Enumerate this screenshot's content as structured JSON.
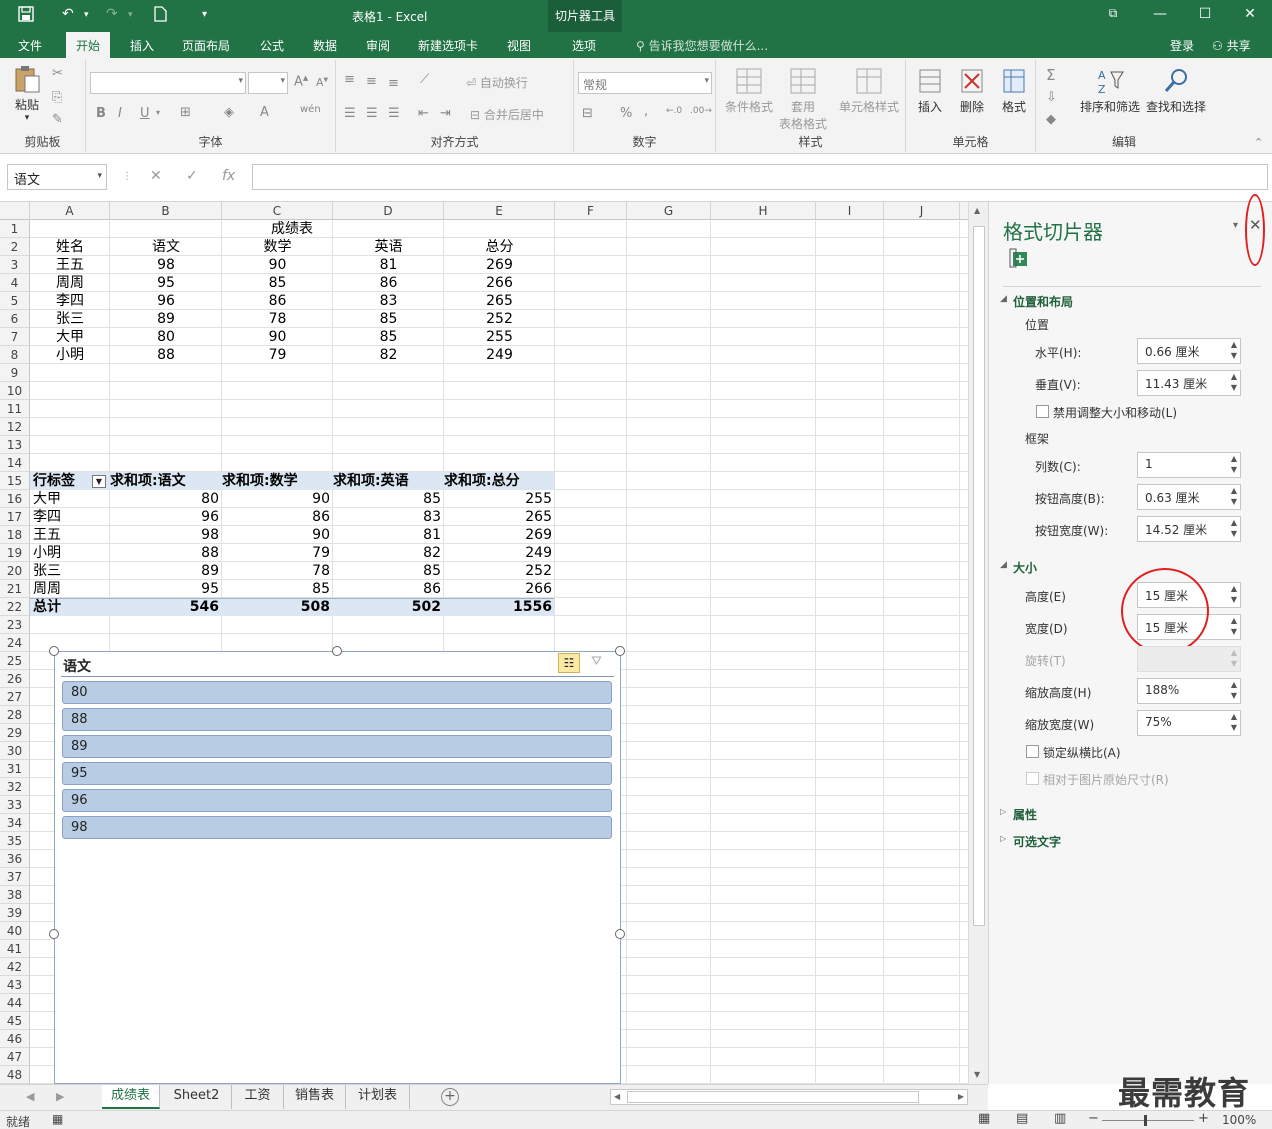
{
  "title_bar": {
    "title": "表格1 - Excel",
    "context_tool": "切片器工具",
    "save_icon": "save-icon",
    "undo_icon": "undo-icon",
    "redo_icon": "redo-icon",
    "new_icon": "new-file-icon"
  },
  "tabs": {
    "file": "文件",
    "home": "开始",
    "insert": "插入",
    "page_layout": "页面布局",
    "formulas": "公式",
    "data": "数据",
    "review": "审阅",
    "new_tab": "新建选项卡",
    "view": "视图",
    "options": "选项",
    "tell_me": "告诉我您想要做什么...",
    "signin": "登录",
    "share": "共享"
  },
  "ribbon": {
    "clipboard": {
      "paste": "粘贴",
      "label": "剪贴板"
    },
    "font": {
      "label": "字体",
      "wen": "wén"
    },
    "alignment": {
      "wrap": "自动换行",
      "merge": "合并后居中",
      "label": "对齐方式"
    },
    "number": {
      "format": "常规",
      "label": "数字",
      "percent": "%"
    },
    "styles": {
      "conditional": "条件格式",
      "table_line1": "套用",
      "table_line2": "表格格式",
      "cell_styles": "单元格样式",
      "label": "样式"
    },
    "cells": {
      "insert": "插入",
      "delete": "删除",
      "format": "格式",
      "label": "单元格"
    },
    "editing": {
      "sort_filter": "排序和筛选",
      "find_select": "查找和选择",
      "label": "编辑"
    }
  },
  "formula_bar": {
    "name_box": "语文",
    "cancel": "✕",
    "enter": "✓",
    "fx": "fx",
    "value": ""
  },
  "columns": [
    "A",
    "B",
    "C",
    "D",
    "E",
    "F",
    "G",
    "H",
    "I",
    "J"
  ],
  "rows": [
    "1",
    "2",
    "3",
    "4",
    "5",
    "6",
    "7",
    "8",
    "9",
    "10",
    "11",
    "12",
    "13",
    "14",
    "15",
    "16",
    "17",
    "18",
    "19",
    "20",
    "21",
    "22",
    "23",
    "24",
    "25",
    "26",
    "27",
    "28",
    "29",
    "30",
    "31",
    "32",
    "33",
    "34",
    "35",
    "36",
    "37",
    "38",
    "39",
    "40",
    "41",
    "42",
    "43",
    "44",
    "45",
    "46",
    "47",
    "48"
  ],
  "score_table": {
    "title": "成绩表",
    "headers": [
      "姓名",
      "语文",
      "数学",
      "英语",
      "总分"
    ],
    "rows": [
      [
        "王五",
        "98",
        "90",
        "81",
        "269"
      ],
      [
        "周周",
        "95",
        "85",
        "86",
        "266"
      ],
      [
        "李四",
        "96",
        "86",
        "83",
        "265"
      ],
      [
        "张三",
        "89",
        "78",
        "85",
        "252"
      ],
      [
        "大甲",
        "80",
        "90",
        "85",
        "255"
      ],
      [
        "小明",
        "88",
        "79",
        "82",
        "249"
      ]
    ]
  },
  "pivot_table": {
    "headers": [
      "行标签",
      "求和项:语文",
      "求和项:数学",
      "求和项:英语",
      "求和项:总分"
    ],
    "rows": [
      [
        "大甲",
        "80",
        "90",
        "85",
        "255"
      ],
      [
        "李四",
        "96",
        "86",
        "83",
        "265"
      ],
      [
        "王五",
        "98",
        "90",
        "81",
        "269"
      ],
      [
        "小明",
        "88",
        "79",
        "82",
        "249"
      ],
      [
        "张三",
        "89",
        "78",
        "85",
        "252"
      ],
      [
        "周周",
        "95",
        "85",
        "86",
        "266"
      ]
    ],
    "total": [
      "总计",
      "546",
      "508",
      "502",
      "1556"
    ]
  },
  "slicer": {
    "title": "语文",
    "items": [
      "80",
      "88",
      "89",
      "95",
      "96",
      "98"
    ]
  },
  "format_pane": {
    "title": "格式切片器",
    "section_position": "位置和布局",
    "position_label": "位置",
    "horizontal_label": "水平(H):",
    "horizontal_value": "0.66 厘米",
    "vertical_label": "垂直(V):",
    "vertical_value": "11.43 厘米",
    "disable_resize": "禁用调整大小和移动(L)",
    "frame_label": "框架",
    "columns_label": "列数(C):",
    "columns_value": "1",
    "button_height_label": "按钮高度(B):",
    "button_height_value": "0.63 厘米",
    "button_width_label": "按钮宽度(W):",
    "button_width_value": "14.52 厘米",
    "section_size": "大小",
    "height_label": "高度(E)",
    "height_value": "15 厘米",
    "width_label": "宽度(D)",
    "width_value": "15 厘米",
    "rotation_label": "旋转(T)",
    "rotation_value": "",
    "scale_height_label": "缩放高度(H)",
    "scale_height_value": "188%",
    "scale_width_label": "缩放宽度(W)",
    "scale_width_value": "75%",
    "lock_aspect": "锁定纵横比(A)",
    "relative_original": "相对于图片原始尺寸(R)",
    "section_properties": "属性",
    "section_alt_text": "可选文字"
  },
  "sheet_tabs": [
    "成绩表",
    "Sheet2",
    "工资",
    "销售表",
    "计划表"
  ],
  "status_bar": {
    "ready": "就绪",
    "zoom": "100%"
  },
  "watermark": "最需教育",
  "colors": {
    "excel_green": "#217346",
    "slicer_item": "#b8cce4",
    "pivot_header": "#dde7f3",
    "annotation_red": "#e02020"
  }
}
